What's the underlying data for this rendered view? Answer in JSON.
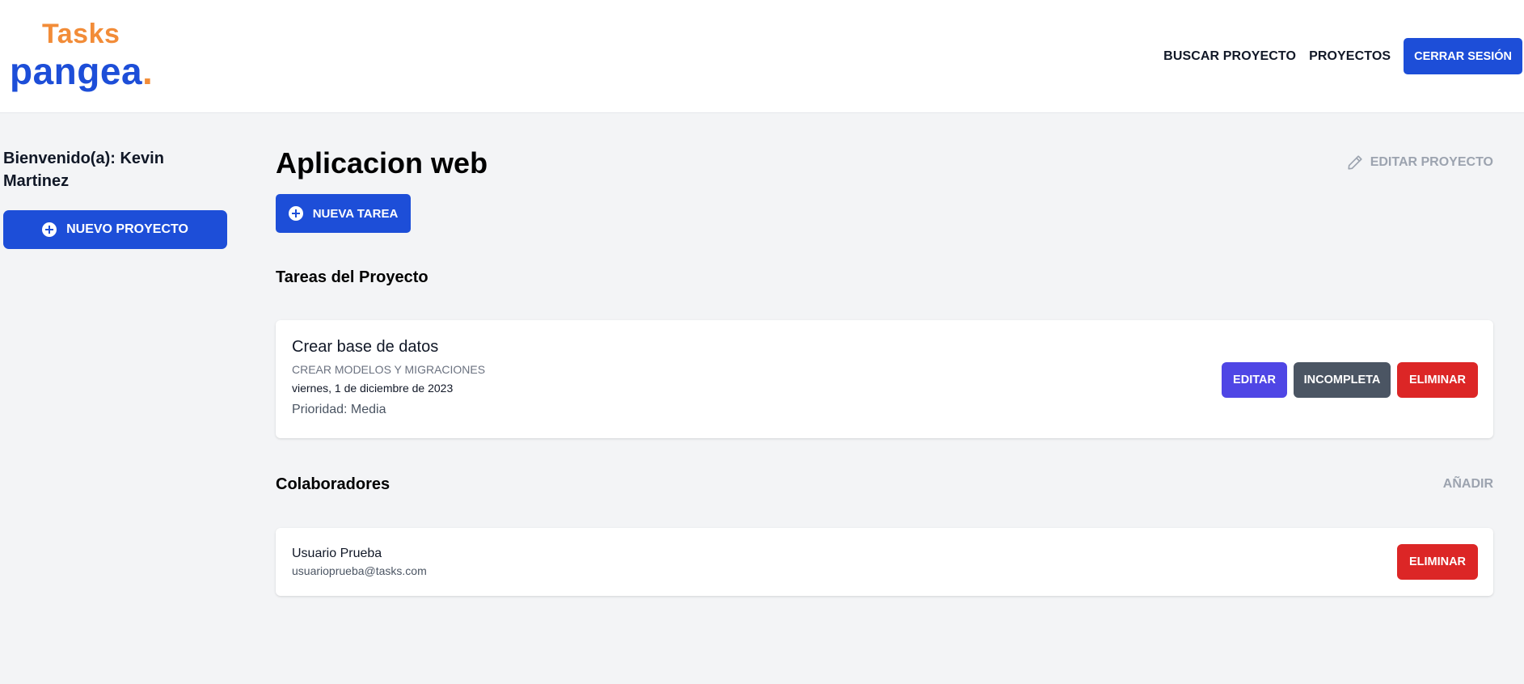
{
  "brand": {
    "top": "Tasks",
    "bottom": "pangea",
    "dot": ".",
    "primary_color": "#1d4ed8",
    "accent_color": "#f28c38"
  },
  "nav": {
    "search_project": "BUSCAR PROYECTO",
    "projects": "PROYECTOS",
    "logout": "CERRAR SESIÓN"
  },
  "sidebar": {
    "welcome": "Bienvenido(a): Kevin Martinez",
    "new_project": "NUEVO PROYECTO",
    "new_project_icon": "plus-circle-icon"
  },
  "project": {
    "title": "Aplicacion web",
    "edit_label": "EDITAR PROYECTO",
    "edit_icon": "pencil-icon",
    "new_task": "NUEVA TAREA",
    "new_task_icon": "plus-circle-icon"
  },
  "tasks": {
    "section_title": "Tareas del Proyecto",
    "items": [
      {
        "name": "Crear base de datos",
        "description": "CREAR MODELOS Y MIGRACIONES",
        "date": "viernes, 1 de diciembre de 2023",
        "priority": "Prioridad: Media",
        "edit": "EDITAR",
        "status": "INCOMPLETA",
        "delete": "ELIMINAR"
      }
    ]
  },
  "collaborators": {
    "section_title": "Colaboradores",
    "add_label": "AÑADIR",
    "items": [
      {
        "name": "Usuario Prueba",
        "email": "usuarioprueba@tasks.com",
        "delete": "ELIMINAR"
      }
    ]
  },
  "colors": {
    "page_bg": "#f3f4f6",
    "edit_button": "#4f46e5",
    "incomplete_button": "#4b5563",
    "delete_button": "#dc2626",
    "muted_text": "#9ca3af"
  }
}
